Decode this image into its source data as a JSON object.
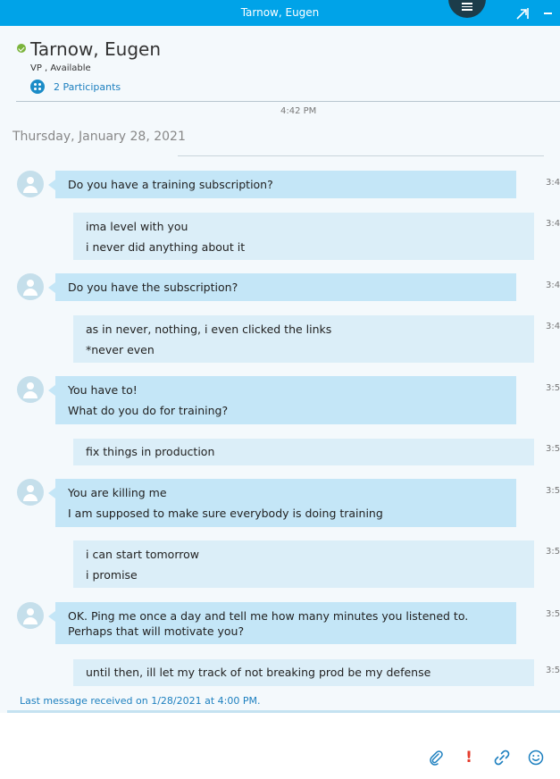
{
  "window": {
    "title": "Tarnow, Eugen"
  },
  "contact": {
    "name": "Tarnow, Eugen",
    "title_status": "VP , Available",
    "participants": "2 Participants"
  },
  "conversation": {
    "prev_time": "4:42 PM",
    "date": "Thursday, January 28, 2021",
    "messages": [
      {
        "direction": "in",
        "lines": [
          "Do you have a training subscription?"
        ],
        "time": "3:4"
      },
      {
        "direction": "out",
        "lines": [
          "ima level with you",
          "i never did anything about it"
        ],
        "time": "3:4"
      },
      {
        "direction": "in",
        "lines": [
          "Do you have the subscription?"
        ],
        "time": "3:4"
      },
      {
        "direction": "out",
        "lines": [
          "as in never, nothing, i even clicked the links",
          "*never even"
        ],
        "time": "3:4"
      },
      {
        "direction": "in",
        "lines": [
          "You have to!",
          "What do you do for training?"
        ],
        "time": "3:5"
      },
      {
        "direction": "out",
        "lines": [
          "fix things in production"
        ],
        "time": "3:5"
      },
      {
        "direction": "in",
        "lines": [
          "You are killing me",
          "I am supposed to make sure everybody is doing training"
        ],
        "time": "3:5"
      },
      {
        "direction": "out",
        "lines": [
          "i can start tomorrow",
          "i promise"
        ],
        "time": "3:5"
      },
      {
        "direction": "in",
        "lines": [
          "OK. Ping me once a day and tell me how many minutes you listened to. Perhaps that will motivate you?"
        ],
        "time": "3:5"
      },
      {
        "direction": "out",
        "lines": [
          "until then, ill let my track of not breaking prod be my defense"
        ],
        "time": "3:5"
      }
    ],
    "last_received": "Last message received on 1/28/2021 at 4:00 PM."
  },
  "toolbar": {
    "attach_icon": "paperclip-icon",
    "important_icon": "exclamation-icon",
    "link_icon": "link-icon",
    "emoji_icon": "smiley-icon"
  },
  "colors": {
    "titlebar": "#00a3e8",
    "incoming_bubble": "#c4e6f7",
    "outgoing_bubble": "#dbeef8",
    "link": "#1c7fbf",
    "presence_available": "#7bb43c"
  }
}
